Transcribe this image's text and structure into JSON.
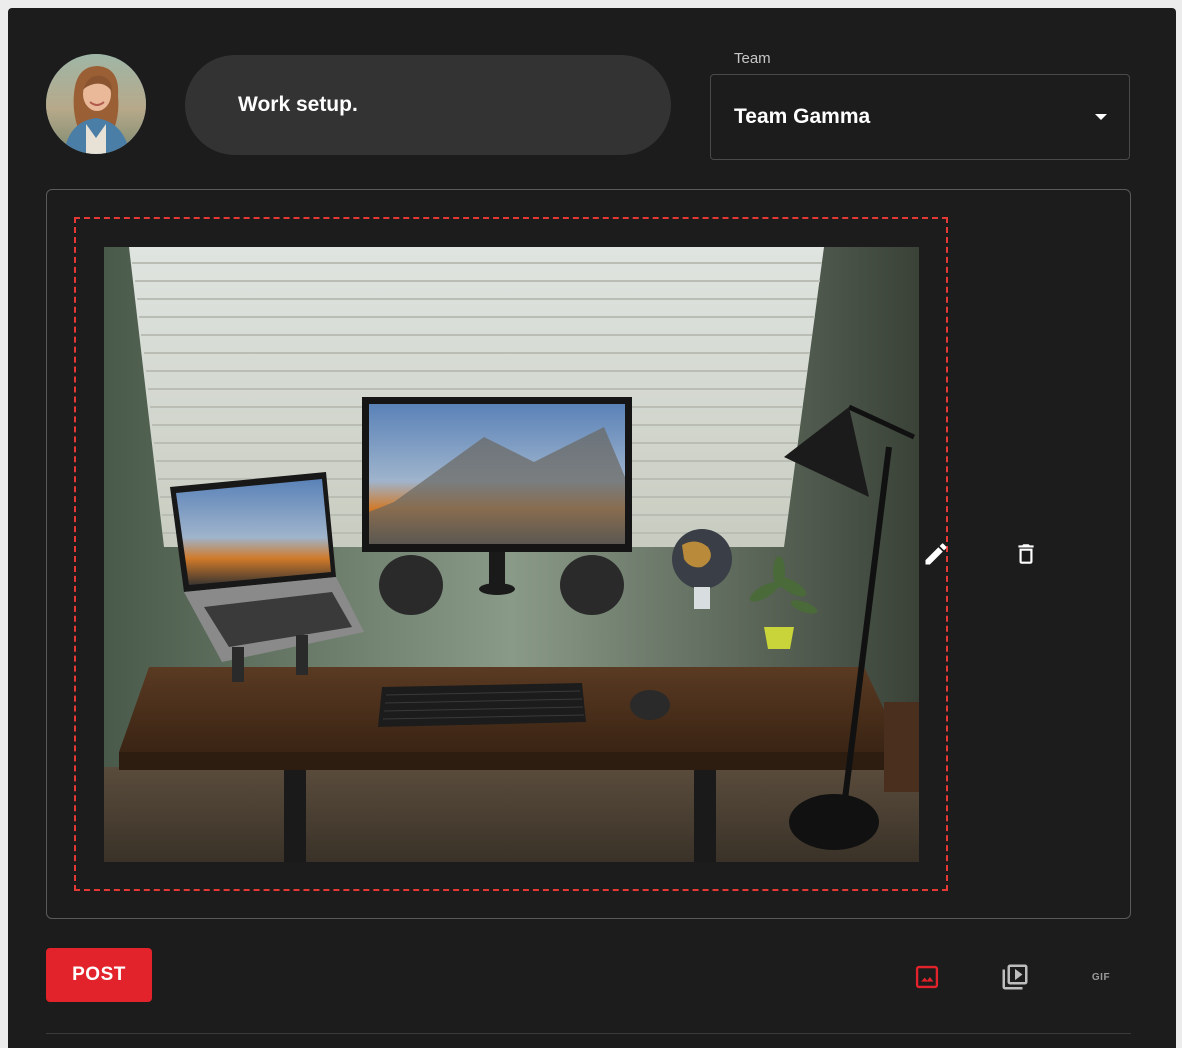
{
  "composer": {
    "text": "Work setup."
  },
  "team": {
    "label": "Team",
    "selected": "Team Gamma"
  },
  "actions": {
    "post_label": "POST",
    "gif_label": "GIF"
  },
  "icons": {
    "edit": "pencil-icon",
    "delete": "trash-icon",
    "image": "image-icon",
    "video": "video-library-icon",
    "gif": "gif-icon",
    "dropdown": "caret-down-icon"
  },
  "colors": {
    "accent": "#e3232b",
    "background": "#1c1c1c",
    "input": "#333333"
  }
}
